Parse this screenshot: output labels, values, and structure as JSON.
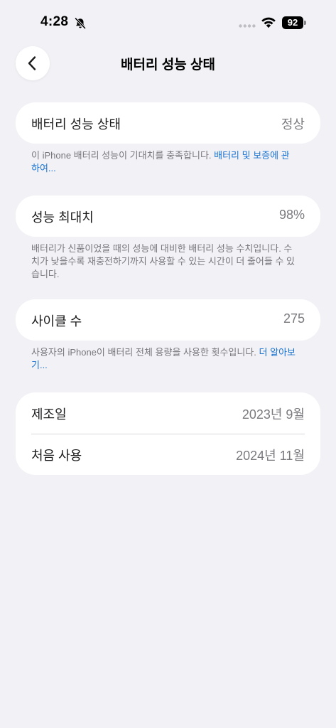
{
  "status_bar": {
    "time": "4:28",
    "battery_level": "92"
  },
  "header": {
    "title": "배터리 성능 상태",
    "back_icon": "chevron-left-icon"
  },
  "health_section": {
    "label": "배터리 성능 상태",
    "value": "정상",
    "footnote_text": "이 iPhone 배터리 성능이 기대치를 충족합니다. ",
    "footnote_link": "배터리 및 보증에 관하여..."
  },
  "capacity_section": {
    "label": "성능 최대치",
    "value": "98%",
    "footnote_text": "배터리가 신품이었을 때의 성능에 대비한 배터리 성능 수치입니다. 수치가 낮을수록 재충전하기까지 사용할 수 있는 시간이 더 줄어들 수 있습니다."
  },
  "cycle_section": {
    "label": "사이클 수",
    "value": "275",
    "footnote_text": "사용자의 iPhone이 배터리 전체 용량을 사용한 횟수입니다. ",
    "footnote_link": "더 알아보기..."
  },
  "dates_section": {
    "manufacture_label": "제조일",
    "manufacture_value": "2023년 9월",
    "first_use_label": "처음 사용",
    "first_use_value": "2024년 11월"
  },
  "colors": {
    "background": "#f2f2f6",
    "card": "#ffffff",
    "link": "#1a73d0",
    "secondary_text": "#7a7a7f"
  }
}
